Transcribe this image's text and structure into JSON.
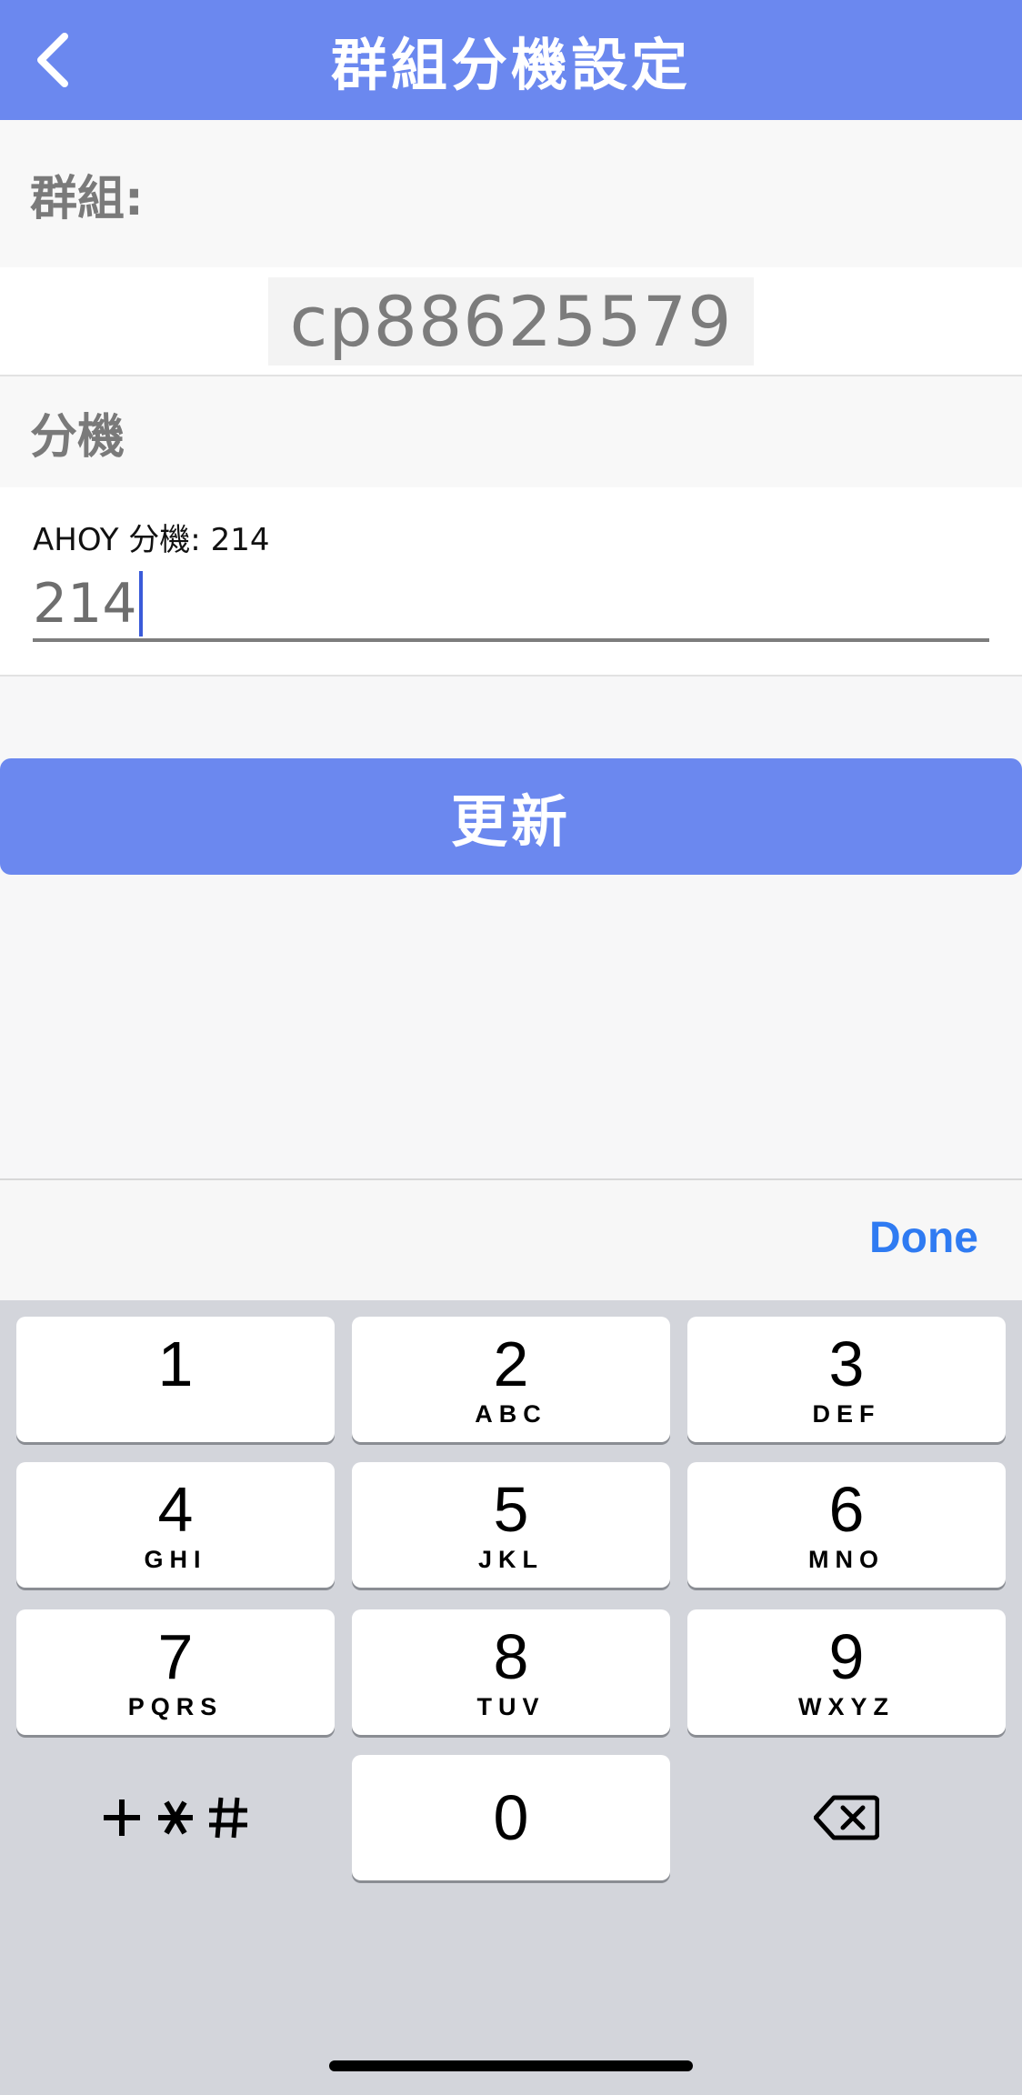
{
  "header": {
    "title": "群組分機設定",
    "accent_color": "#6b88ef",
    "back_icon": "chevron-left-icon"
  },
  "group": {
    "label": "群組:",
    "value": "cp88625579"
  },
  "extension": {
    "label": "分機",
    "caption": "AHOY 分機: 214",
    "input_value": "214"
  },
  "update_button": {
    "label": "更新"
  },
  "keyboard_toolbar": {
    "done_label": "Done",
    "done_color": "#2f7bf2"
  },
  "keypad": {
    "keys": [
      {
        "digit": "1",
        "letters": ""
      },
      {
        "digit": "2",
        "letters": "ABC"
      },
      {
        "digit": "3",
        "letters": "DEF"
      },
      {
        "digit": "4",
        "letters": "GHI"
      },
      {
        "digit": "5",
        "letters": "JKL"
      },
      {
        "digit": "6",
        "letters": "MNO"
      },
      {
        "digit": "7",
        "letters": "PQRS"
      },
      {
        "digit": "8",
        "letters": "TUV"
      },
      {
        "digit": "9",
        "letters": "WXYZ"
      },
      {
        "digit": "0",
        "letters": ""
      }
    ],
    "symbols_label": "+ * #",
    "delete_icon": "backspace-icon"
  }
}
